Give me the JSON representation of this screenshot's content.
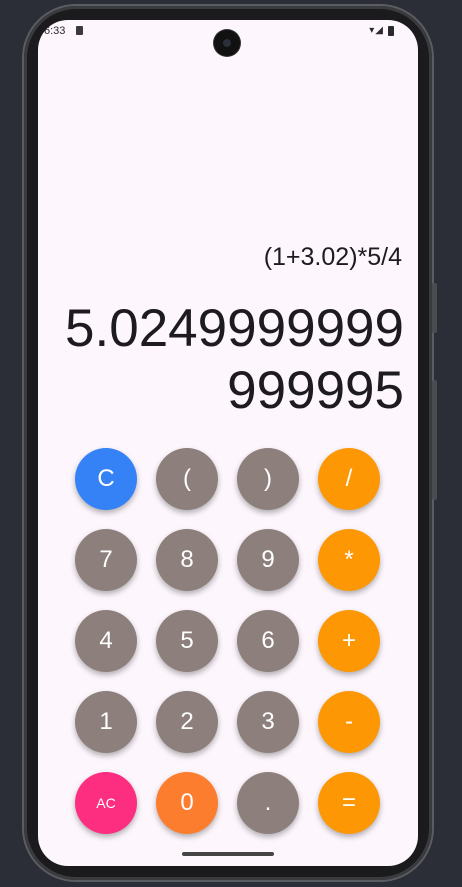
{
  "status_bar": {
    "time": "6:33",
    "icons": "▾◢"
  },
  "display": {
    "expression": "(1+3.02)*5/4",
    "result": "5.0249999999999995"
  },
  "keypad": {
    "keys": [
      {
        "label": "C",
        "name": "clear-button",
        "color": "#3582f7",
        "small": false
      },
      {
        "label": "(",
        "name": "open-paren-button",
        "color": "#8d807c",
        "small": false
      },
      {
        "label": ")",
        "name": "close-paren-button",
        "color": "#8d807c",
        "small": false
      },
      {
        "label": "/",
        "name": "divide-button",
        "color": "#fd9703",
        "small": false
      },
      {
        "label": "7",
        "name": "digit-7-button",
        "color": "#8d807c",
        "small": false
      },
      {
        "label": "8",
        "name": "digit-8-button",
        "color": "#8d807c",
        "small": false
      },
      {
        "label": "9",
        "name": "digit-9-button",
        "color": "#8d807c",
        "small": false
      },
      {
        "label": "*",
        "name": "multiply-button",
        "color": "#fd9703",
        "small": false
      },
      {
        "label": "4",
        "name": "digit-4-button",
        "color": "#8d807c",
        "small": false
      },
      {
        "label": "5",
        "name": "digit-5-button",
        "color": "#8d807c",
        "small": false
      },
      {
        "label": "6",
        "name": "digit-6-button",
        "color": "#8d807c",
        "small": false
      },
      {
        "label": "+",
        "name": "add-button",
        "color": "#fd9703",
        "small": false
      },
      {
        "label": "1",
        "name": "digit-1-button",
        "color": "#8d807c",
        "small": false
      },
      {
        "label": "2",
        "name": "digit-2-button",
        "color": "#8d807c",
        "small": false
      },
      {
        "label": "3",
        "name": "digit-3-button",
        "color": "#8d807c",
        "small": false
      },
      {
        "label": "-",
        "name": "subtract-button",
        "color": "#fd9703",
        "small": false
      },
      {
        "label": "AC",
        "name": "all-clear-button",
        "color": "#fd2e80",
        "small": true
      },
      {
        "label": "0",
        "name": "digit-0-button",
        "color": "#fd7d2e",
        "small": false
      },
      {
        "label": ".",
        "name": "decimal-button",
        "color": "#8d807c",
        "small": false
      },
      {
        "label": "=",
        "name": "equals-button",
        "color": "#fd9703",
        "small": false
      }
    ]
  }
}
